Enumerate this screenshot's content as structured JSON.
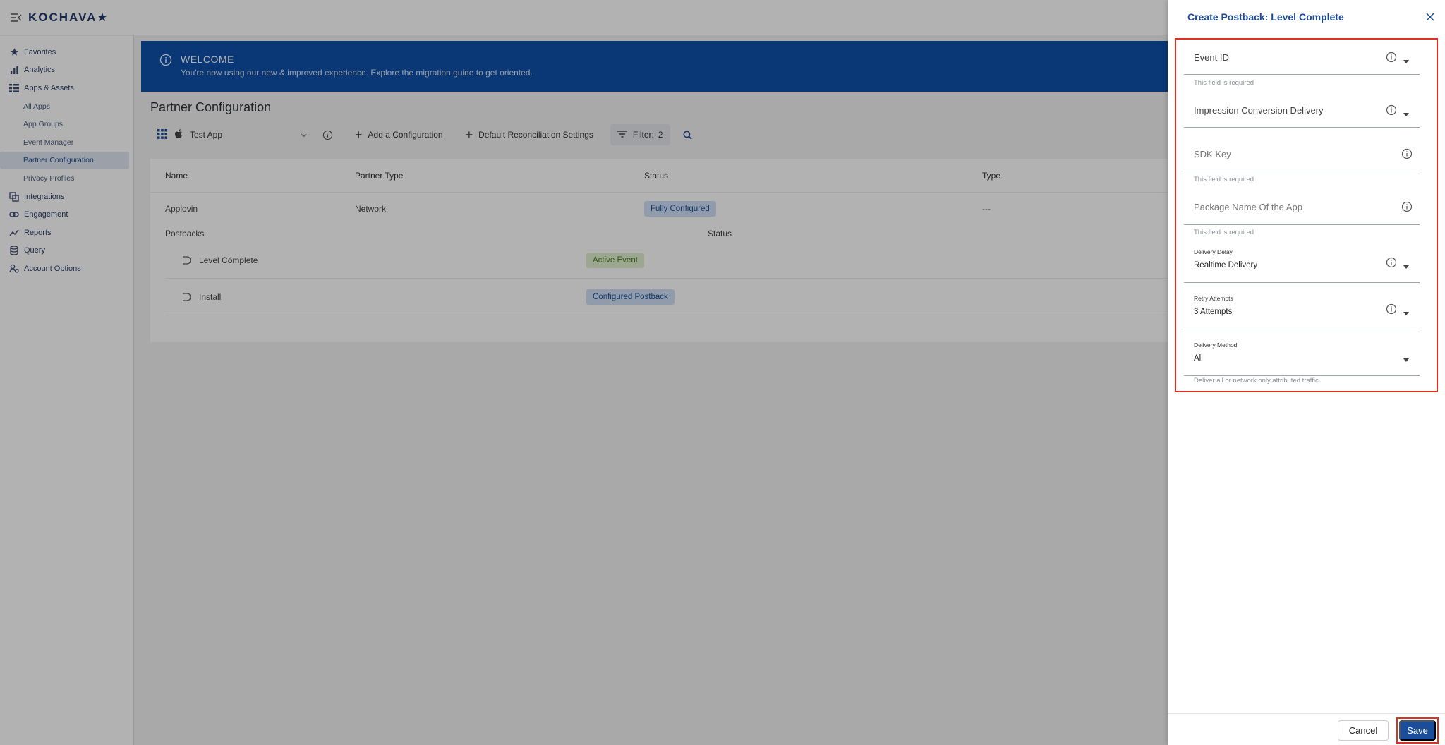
{
  "topbar": {
    "logo": "KOCHAVA★"
  },
  "sidebar": {
    "items": [
      {
        "label": "Favorites",
        "icon": "star-icon"
      },
      {
        "label": "Analytics",
        "icon": "bar-chart-icon"
      },
      {
        "label": "Apps & Assets",
        "icon": "apps-list-icon"
      }
    ],
    "sub_items": [
      {
        "label": "All Apps"
      },
      {
        "label": "App Groups"
      },
      {
        "label": "Event Manager"
      },
      {
        "label": "Partner Configuration"
      },
      {
        "label": "Privacy Profiles"
      }
    ],
    "items_after": [
      {
        "label": "Integrations",
        "icon": "integrations-icon"
      },
      {
        "label": "Engagement",
        "icon": "link-icon"
      },
      {
        "label": "Reports",
        "icon": "trend-icon"
      },
      {
        "label": "Query",
        "icon": "database-icon"
      },
      {
        "label": "Account Options",
        "icon": "account-icon"
      }
    ]
  },
  "banner": {
    "title": "WELCOME",
    "text": "You're now using our new & improved experience. Explore the migration guide to get oriented."
  },
  "page": {
    "title": "Partner Configuration"
  },
  "toolbar": {
    "app_name": "Test App",
    "add_config": "Add a Configuration",
    "default_reconciliation": "Default Reconciliation Settings",
    "filter_label": "Filter:",
    "filter_count": "2"
  },
  "table": {
    "headers": {
      "name": "Name",
      "partner_type": "Partner Type",
      "status": "Status",
      "type": "Type"
    },
    "row": {
      "name": "Applovin",
      "partner_type": "Network",
      "status": "Fully Configured",
      "type": "---"
    },
    "postbacks_header": {
      "label": "Postbacks",
      "status": "Status"
    },
    "postbacks": [
      {
        "name": "Level Complete",
        "status": "Active Event"
      },
      {
        "name": "Install",
        "status": "Configured Postback"
      }
    ]
  },
  "drawer": {
    "title": "Create Postback: Level Complete",
    "fields": {
      "event_id": {
        "label": "Event ID",
        "helper": "This field is required"
      },
      "impression": {
        "label": "Impression Conversion Delivery"
      },
      "sdk_key": {
        "label": "SDK Key",
        "helper": "This field is required"
      },
      "package_name": {
        "label": "Package Name Of the App",
        "helper": "This field is required"
      },
      "delivery_delay": {
        "label": "Delivery Delay",
        "value": "Realtime Delivery"
      },
      "retry_attempts": {
        "label": "Retry Attempts",
        "value": "3 Attempts"
      },
      "delivery_method": {
        "label": "Delivery Method",
        "value": "All",
        "helper": "Deliver all or network only attributed traffic"
      }
    },
    "cancel": "Cancel",
    "save": "Save"
  },
  "colors": {
    "brand": "#1a4d9a",
    "banner": "#0f4fa8",
    "highlight": "#e0301e"
  }
}
